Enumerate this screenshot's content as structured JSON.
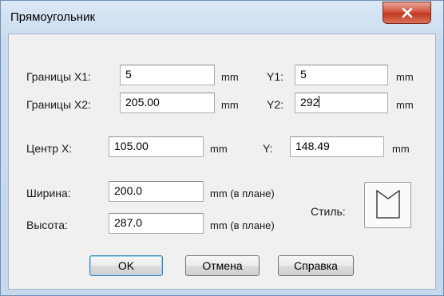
{
  "window": {
    "title": "Прямоугольник"
  },
  "bounds_x1": {
    "label": "Границы X1:",
    "value": "5",
    "unit": "mm"
  },
  "bounds_y1": {
    "label": "Y1:",
    "value": "5",
    "unit": "mm"
  },
  "bounds_x2": {
    "label": "Границы X2:",
    "value": "205.00",
    "unit": "mm"
  },
  "bounds_y2": {
    "label": "Y2:",
    "value": "292",
    "unit": "mm"
  },
  "center_x": {
    "label": "Центр X:",
    "value": "105.00",
    "unit": "mm"
  },
  "center_y": {
    "label": "Y:",
    "value": "148.49",
    "unit": "mm"
  },
  "width": {
    "label": "Ширина:",
    "value": "200.0",
    "unit": "mm (в плане)"
  },
  "height": {
    "label": "Высота:",
    "value": "287.0",
    "unit": "mm (в плане)"
  },
  "style": {
    "label": "Стиль:",
    "icon": "rectangle-style-icon"
  },
  "buttons": {
    "ok": "OK",
    "cancel": "Отмена",
    "help": "Справка"
  },
  "icons": {
    "close": "close-icon"
  },
  "colors": {
    "close_button": "#c23a22",
    "title_bar": "#c9dcef",
    "dialog_bg": "#f0f0f0"
  }
}
